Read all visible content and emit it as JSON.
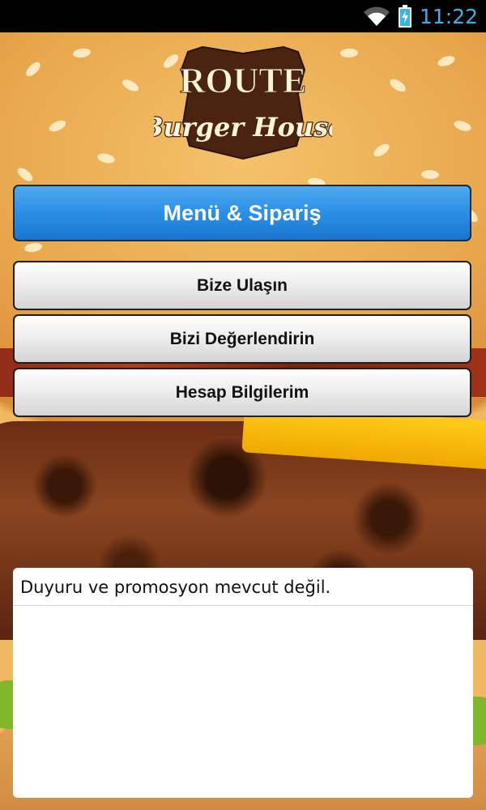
{
  "status_bar": {
    "time": "11:22",
    "icons": [
      "wifi-icon",
      "battery-charging-icon"
    ],
    "time_color": "#33b5e5"
  },
  "logo": {
    "line1": "ROUTE",
    "line2": "Burger House"
  },
  "buttons": {
    "menu_order": "Menü & Sipariş",
    "contact": "Bize Ulaşın",
    "rate": "Bizi Değerlendirin",
    "account": "Hesap Bilgilerim"
  },
  "announcements": {
    "message": "Duyuru ve promosyon mevcut değil."
  },
  "colors": {
    "primary_button": "#2b8fe5",
    "logo_brown": "#5a2c14"
  }
}
